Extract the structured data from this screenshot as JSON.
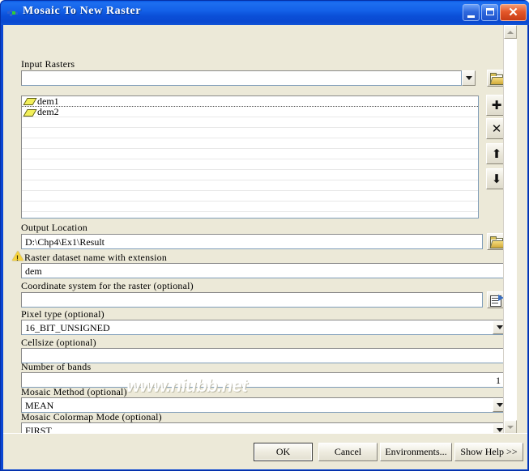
{
  "window": {
    "title": "Mosaic To New Raster",
    "icon": "arctoolbox-tool-icon",
    "buttons": {
      "minimize": "_",
      "maximize": "□",
      "close": "✕"
    }
  },
  "form": {
    "input_rasters": {
      "label": "Input Rasters",
      "combo_value": "",
      "items": [
        {
          "name": "dem1",
          "icon": "raster-layer-icon"
        },
        {
          "name": "dem2",
          "icon": "raster-layer-icon"
        }
      ],
      "tools": [
        {
          "name": "browse-folder",
          "glyph": "folder"
        },
        {
          "name": "add",
          "glyph": "✚"
        },
        {
          "name": "remove",
          "glyph": "✕"
        },
        {
          "name": "move-up",
          "glyph": "⬆"
        },
        {
          "name": "move-down",
          "glyph": "⬇"
        }
      ]
    },
    "output_location": {
      "label": "Output Location",
      "value": "D:\\Chp4\\Ex1\\Result",
      "browse": "folder"
    },
    "raster_name": {
      "label": "Raster dataset name with extension",
      "value": "dem",
      "warning": true
    },
    "coordinate_system": {
      "label": "Coordinate system for the raster (optional)",
      "value": "",
      "browse": "spatial-reference"
    },
    "pixel_type": {
      "label": "Pixel type (optional)",
      "value": "16_BIT_UNSIGNED"
    },
    "cellsize": {
      "label": "Cellsize (optional)",
      "value": ""
    },
    "number_of_bands": {
      "label": "Number of bands",
      "value": "1"
    },
    "mosaic_method": {
      "label": "Mosaic Method (optional)",
      "value": "MEAN"
    },
    "mosaic_colormap_mode": {
      "label": "Mosaic Colormap Mode (optional)",
      "value": "FIRST"
    }
  },
  "watermark": "www.niubb.net",
  "footer": {
    "ok": "OK",
    "cancel": "Cancel",
    "environments": "Environments...",
    "show_help": "Show Help >>"
  },
  "colors": {
    "dialog_bg": "#ECE9D8",
    "titlebar_blue": "#0A4FD8",
    "field_bg": "#FFFFFF",
    "raster_icon_yellow": "#F2EF5A",
    "warning_yellow": "#F6D33C"
  }
}
